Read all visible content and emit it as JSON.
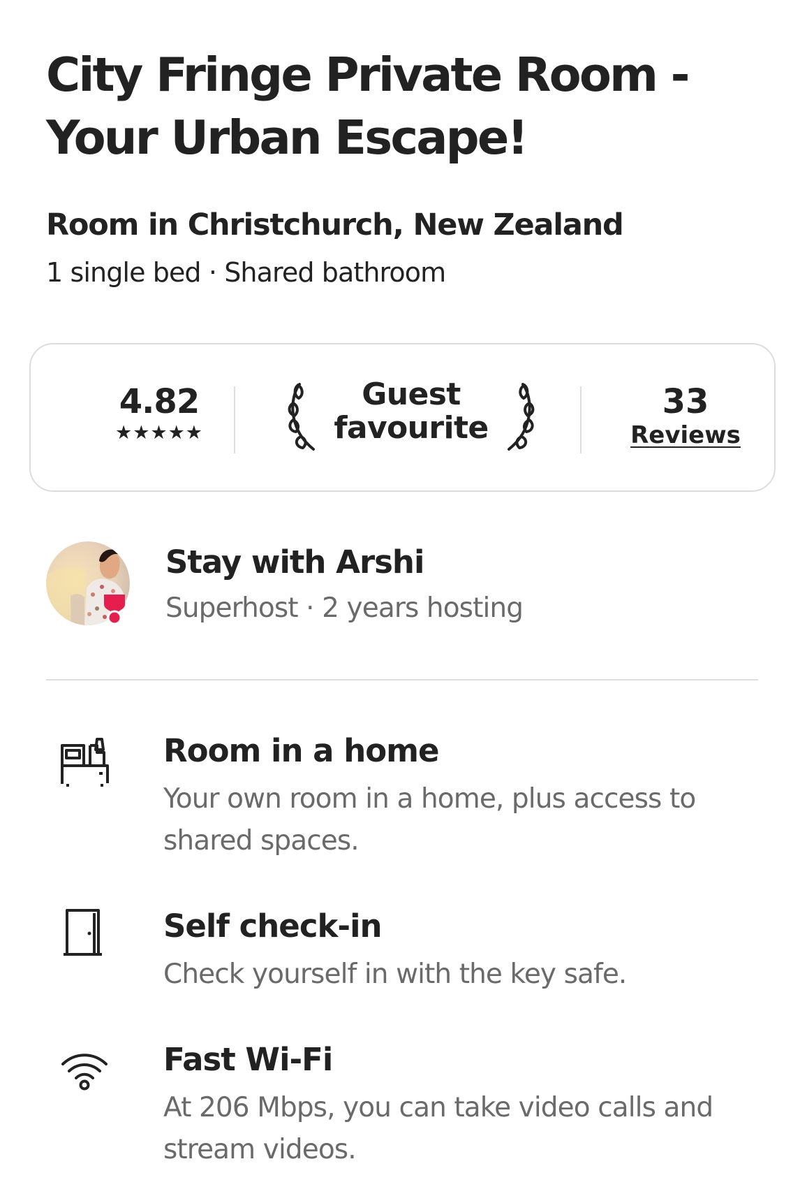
{
  "listing": {
    "title_line_1": "City Fringe Private Room -",
    "title_line_2": "Your Urban Escape!",
    "location": "Room in Christchurch, New Zealand",
    "details": "1 single bed · Shared bathroom"
  },
  "rating_card": {
    "rating": "4.82",
    "stars": "★★★★★",
    "star_count": 5,
    "badge_line_1": "Guest",
    "badge_line_2": "favourite",
    "reviews_count": "33",
    "reviews_label": "Reviews"
  },
  "host": {
    "heading": "Stay with Arshi",
    "meta": "Superhost · 2 years hosting"
  },
  "highlights": [
    {
      "icon": "bed-icon",
      "title": "Room in a home",
      "description": "Your own room in a home, plus access to shared spaces."
    },
    {
      "icon": "door-icon",
      "title": "Self check-in",
      "description": "Check yourself in with the key safe."
    },
    {
      "icon": "wifi-icon",
      "title": "Fast Wi-Fi",
      "description": "At 206 Mbps, you can take video calls and stream videos."
    }
  ],
  "colors": {
    "text": "#222222",
    "secondary_text": "#6a6a6a",
    "border": "#dddddd",
    "superhost_badge": "#e61e4d"
  }
}
